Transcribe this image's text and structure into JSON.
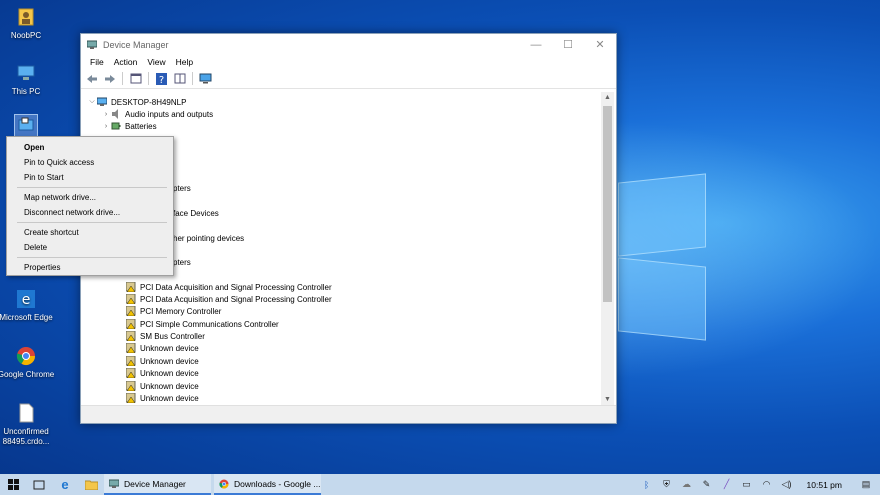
{
  "desktop": {
    "icons": [
      {
        "label": "NoobPC",
        "icon": "folder-icon"
      },
      {
        "label": "This PC",
        "icon": "computer-icon"
      },
      {
        "label": "",
        "icon": "network-icon"
      },
      {
        "label": "Microsoft Edge",
        "icon": "edge-icon"
      },
      {
        "label": "Google Chrome",
        "icon": "chrome-icon"
      },
      {
        "label": "Unconfirmed 88495.crdo...",
        "icon": "file-icon"
      }
    ]
  },
  "window": {
    "title": "Device Manager",
    "controls": {
      "minimize": "—",
      "maximize": "☐",
      "close": "✕"
    },
    "menu": [
      "File",
      "Action",
      "View",
      "Help"
    ],
    "tree": {
      "root": "DESKTOP-8H49NLP",
      "categories": [
        {
          "label": "Audio inputs and outputs"
        },
        {
          "label": "Batteries"
        },
        {
          "label": "pters"
        },
        {
          "label": "face Devices"
        },
        {
          "label": "her pointing devices"
        },
        {
          "label": "pters"
        }
      ],
      "devices": [
        "PCI Data Acquisition and Signal Processing Controller",
        "PCI Data Acquisition and Signal Processing Controller",
        "PCI Memory Controller",
        "PCI Simple Communications Controller",
        "SM Bus Controller",
        "Unknown device",
        "Unknown device",
        "Unknown device",
        "Unknown device",
        "Unknown device"
      ]
    },
    "scrollbar": {
      "up": "▲",
      "down": "▼"
    }
  },
  "context_menu": {
    "groups": [
      [
        {
          "label": "Open",
          "bold": true
        },
        {
          "label": "Pin to Quick access"
        },
        {
          "label": "Pin to Start"
        }
      ],
      [
        {
          "label": "Map network drive..."
        },
        {
          "label": "Disconnect network drive..."
        }
      ],
      [
        {
          "label": "Create shortcut"
        },
        {
          "label": "Delete"
        }
      ],
      [
        {
          "label": "Properties"
        }
      ]
    ]
  },
  "taskbar": {
    "tasks": [
      {
        "label": "Device Manager",
        "icon": "device-manager-icon"
      },
      {
        "label": "Downloads - Google ...",
        "icon": "chrome-icon"
      }
    ],
    "tray": {
      "time": "10:51 pm"
    }
  },
  "colors": {
    "accent": "#3b7bd6",
    "taskbar": "#c5d9ed",
    "desktop": "#0b4fb5"
  }
}
